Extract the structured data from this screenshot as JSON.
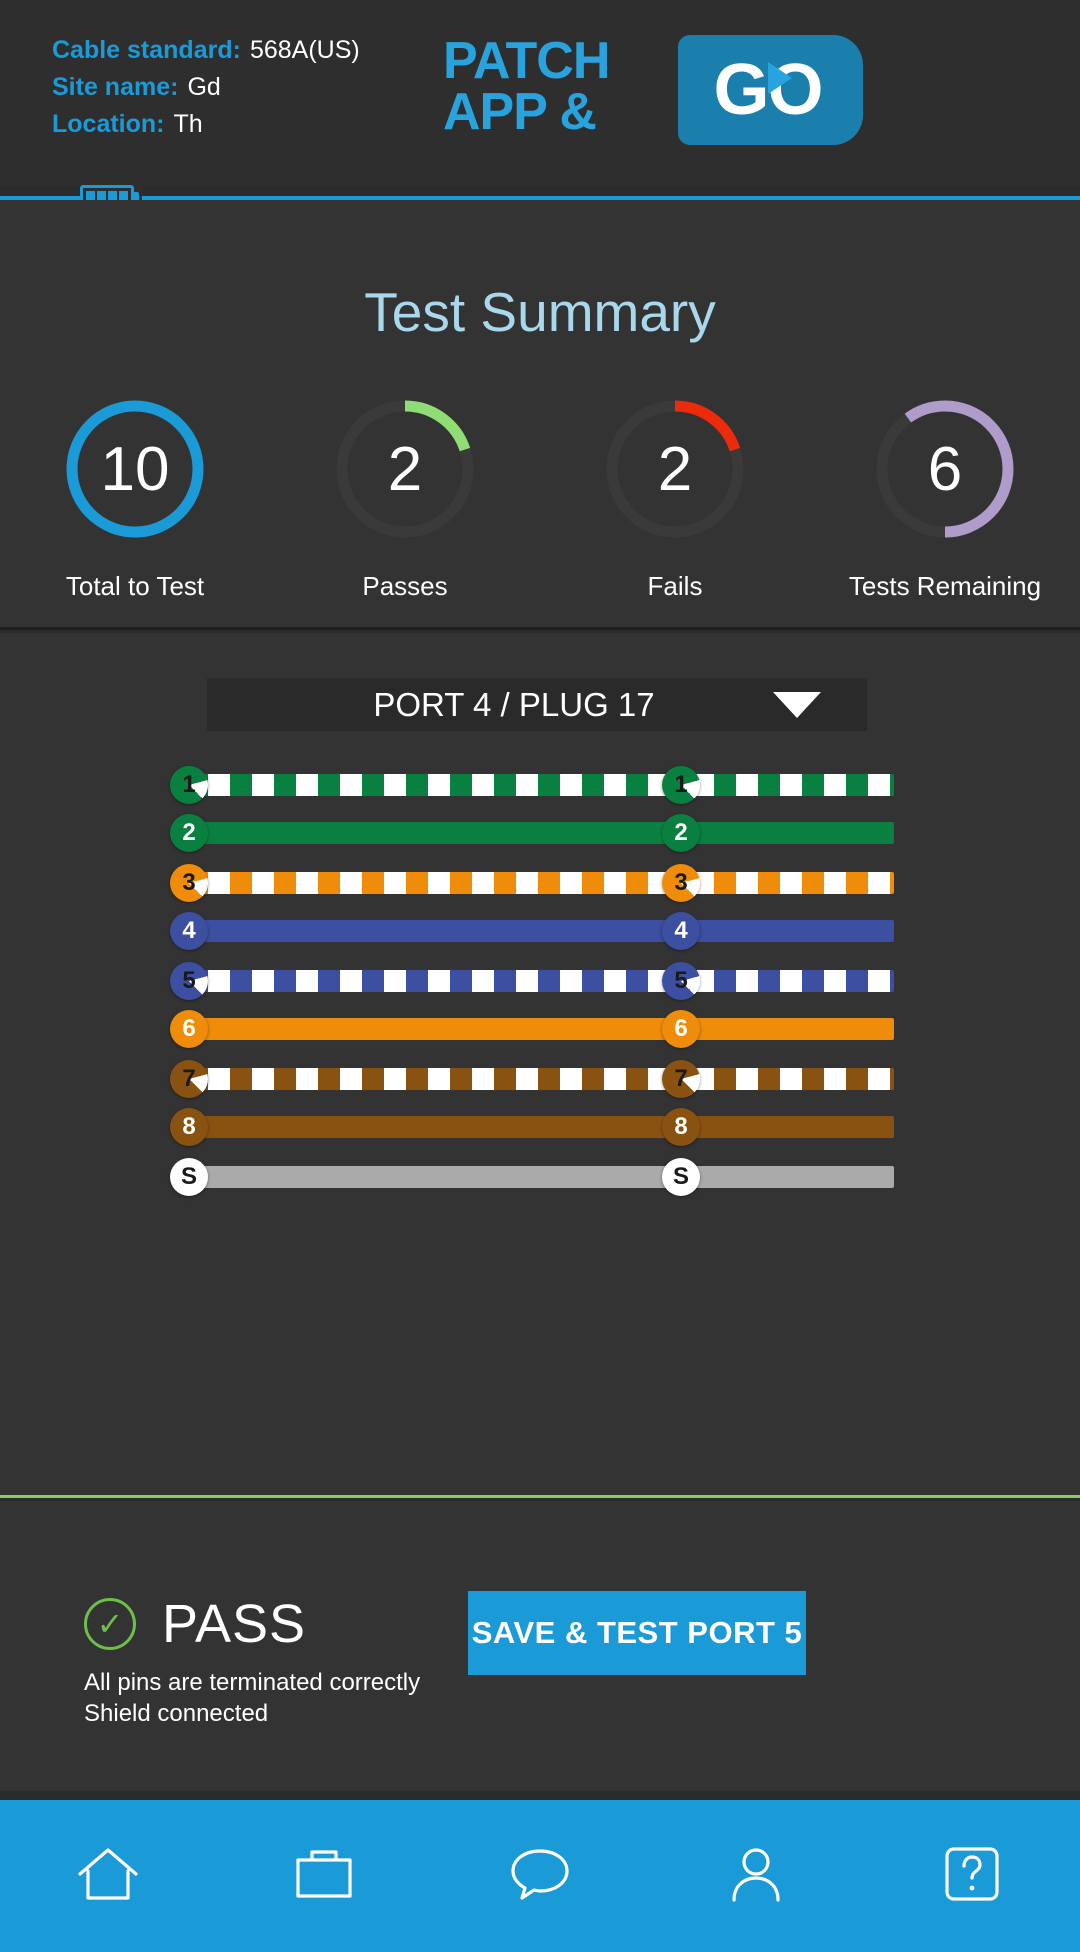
{
  "header": {
    "fields": [
      {
        "label": "Cable standard:",
        "value": "568A(US)"
      },
      {
        "label": "Site name:",
        "value": "Gd"
      },
      {
        "label": "Location:",
        "value": "Th"
      }
    ],
    "logo": {
      "line1": "PATCH",
      "line2": "APP &",
      "badge": "GO",
      "badge_icon": "play-icon"
    },
    "battery_icon": "battery-icon",
    "accent_color": "#1a9ad7"
  },
  "summary": {
    "title": "Test Summary",
    "gauges": [
      {
        "value": "10",
        "label": "Total to Test",
        "color": "#1a9ad7",
        "percent": 100
      },
      {
        "value": "2",
        "label": "Passes",
        "color": "#8fdd74",
        "percent": 20
      },
      {
        "value": "2",
        "label": "Fails",
        "color": "#ec2a0c",
        "percent": 20
      },
      {
        "value": "6",
        "label": "Tests Remaining",
        "color": "#b09ccb",
        "percent": 60
      }
    ]
  },
  "wire_panel": {
    "selector": {
      "label": "PORT 4 / PLUG 17",
      "caret_icon": "chevron-down-icon"
    },
    "wires": [
      {
        "pin": "1",
        "color": "#0a8040",
        "striped": true,
        "pin_text_color": "#1a1a1a",
        "pin_bg": "#0a8040",
        "shield": false
      },
      {
        "pin": "2",
        "color": "#0a8040",
        "striped": false,
        "pin_text_color": "#ffffff",
        "pin_bg": "#0a8040",
        "shield": false
      },
      {
        "pin": "3",
        "color": "#ef8c0a",
        "striped": true,
        "pin_text_color": "#1a1a1a",
        "pin_bg": "#ef8c0a",
        "shield": false
      },
      {
        "pin": "4",
        "color": "#3c4fa0",
        "striped": false,
        "pin_text_color": "#ffffff",
        "pin_bg": "#3c4fa0",
        "shield": false
      },
      {
        "pin": "5",
        "color": "#3c4fa0",
        "striped": true,
        "pin_text_color": "#1a1a1a",
        "pin_bg": "#3c4fa0",
        "shield": false
      },
      {
        "pin": "6",
        "color": "#ef8c0a",
        "striped": false,
        "pin_text_color": "#ffffff",
        "pin_bg": "#ef8c0a",
        "shield": false
      },
      {
        "pin": "7",
        "color": "#8a5211",
        "striped": true,
        "pin_text_color": "#1a1a1a",
        "pin_bg": "#8a5211",
        "shield": false
      },
      {
        "pin": "8",
        "color": "#8a5211",
        "striped": false,
        "pin_text_color": "#ffffff",
        "pin_bg": "#8a5211",
        "shield": false
      },
      {
        "pin": "S",
        "color": "#aaaaaa",
        "striped": false,
        "pin_text_color": "#1a1a1a",
        "pin_bg": "#ffffff",
        "shield": true
      }
    ]
  },
  "result": {
    "status_icon": "check-circle-icon",
    "status": "PASS",
    "detail_line1": "All pins are terminated correctly",
    "detail_line2": "Shield connected",
    "save_button": "SAVE & TEST PORT 5",
    "status_color": "#6cbf4a"
  },
  "bottom_nav": {
    "items": [
      {
        "icon": "home-icon",
        "name": "nav-home"
      },
      {
        "icon": "folder-icon",
        "name": "nav-folder"
      },
      {
        "icon": "chat-icon",
        "name": "nav-chat"
      },
      {
        "icon": "person-icon",
        "name": "nav-account"
      },
      {
        "icon": "help-icon",
        "name": "nav-help"
      }
    ]
  }
}
